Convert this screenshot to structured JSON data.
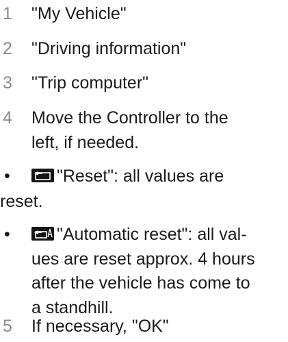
{
  "steps": [
    {
      "num": "1",
      "text": "\"My Vehicle\""
    },
    {
      "num": "2",
      "text": "\"Driving information\""
    },
    {
      "num": "3",
      "text": "\"Trip computer\""
    },
    {
      "num": "4",
      "line1": "Move the Controller to the",
      "line2": "left, if needed."
    },
    {
      "num": "5",
      "text": "If necessary, \"OK\""
    }
  ],
  "bullets": [
    {
      "marker": "•",
      "icon": "trip-reset-icon",
      "line1": "\"Reset\": all values are",
      "line2": "reset."
    },
    {
      "marker": "•",
      "icon": "automatic-trip-reset-icon",
      "line1": "\"Automatic reset\": all val-",
      "line2": "ues are reset approx. 4 hours",
      "line3": "after the vehicle has come to",
      "line4": "a standhill."
    }
  ]
}
